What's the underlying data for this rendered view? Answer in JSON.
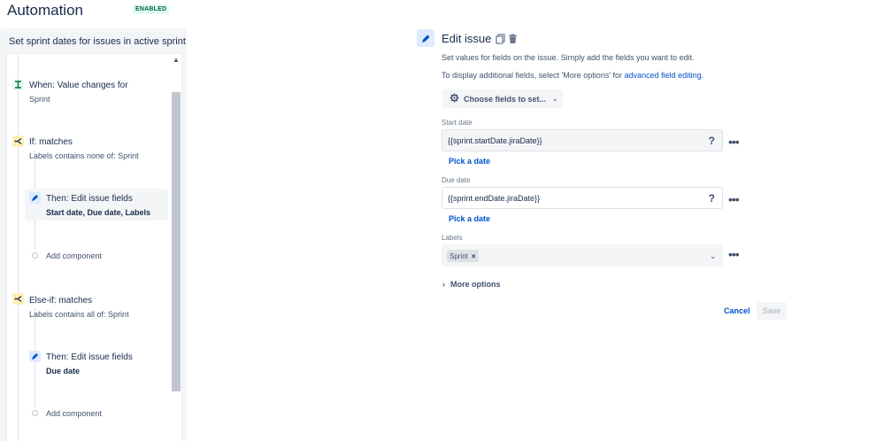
{
  "header": {
    "title": "Automation",
    "status_badge": "ENABLED"
  },
  "rule": {
    "name": "Set sprint dates for issues in active sprint",
    "nodes": [
      {
        "type": "trigger",
        "title": "When: Value changes for",
        "subtitle": "Sprint",
        "icon": "trigger-icon"
      },
      {
        "type": "condition",
        "title": "If: matches",
        "subtitle": "Labels contains none of: Sprint",
        "icon": "branch-icon"
      },
      {
        "type": "action",
        "title": "Then: Edit issue fields",
        "subtitle": "Start date, Due date, Labels",
        "icon": "pencil-icon",
        "selected": true
      },
      {
        "type": "add",
        "title": "Add component"
      },
      {
        "type": "condition",
        "title": "Else-if: matches",
        "subtitle": "Labels contains all of: Sprint",
        "icon": "branch-icon"
      },
      {
        "type": "action",
        "title": "Then: Edit issue fields",
        "subtitle": "Due date",
        "icon": "pencil-icon"
      },
      {
        "type": "add",
        "title": "Add component"
      }
    ]
  },
  "editor": {
    "title": "Edit issue",
    "description": "Set values for fields on the issue. Simply add the fields you want to edit.",
    "additional_prefix": "To display additional fields, select 'More options' for ",
    "additional_link": "advanced field editing.",
    "choose_fields_label": "Choose fields to set...",
    "fields": {
      "start_date": {
        "label": "Start date",
        "value": "{{sprint.startDate.jiraDate}}",
        "pick_label": "Pick a date"
      },
      "due_date": {
        "label": "Due date",
        "value": "{{sprint.endDate.jiraDate}}",
        "pick_label": "Pick a date"
      },
      "labels": {
        "label": "Labels",
        "tags": [
          "Sprint"
        ]
      }
    },
    "help_glyph": "?",
    "more_glyph": "•••",
    "more_options_label": "More options",
    "cancel_label": "Cancel",
    "save_label": "Save"
  },
  "colors": {
    "link": "#0052cc",
    "trigger_bg": "#e3fcef",
    "condition_bg": "#fff0b3",
    "action_bg": "#deebff",
    "badge_text": "#006644"
  }
}
